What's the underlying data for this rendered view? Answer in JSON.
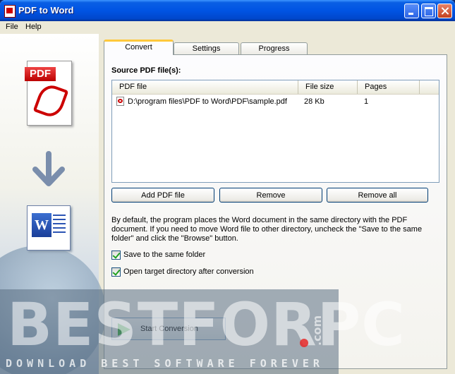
{
  "window": {
    "title": "PDF to Word"
  },
  "menu": {
    "file": "File",
    "help": "Help"
  },
  "sidebar": {
    "pdf_label": "PDF"
  },
  "tabs": [
    "Convert",
    "Settings",
    "Progress"
  ],
  "convert": {
    "source_title": "Source PDF file(s):",
    "columns": [
      "PDF file",
      "File size",
      "Pages"
    ],
    "rows": [
      {
        "file": "D:\\program files\\PDF to Word\\PDF\\sample.pdf",
        "size": "28 Kb",
        "pages": "1"
      }
    ],
    "buttons": {
      "add": "Add PDF file",
      "remove": "Remove",
      "remove_all": "Remove all"
    },
    "description": "By default, the program places the Word document in the same directory with the PDF document. If you need to move Word file to other directory, uncheck the \"Save to the same folder\" and click the \"Browse\" button.",
    "checkboxes": [
      {
        "label": "Save to the same folder",
        "checked": true
      },
      {
        "label": "Open target directory after conversion",
        "checked": true
      }
    ],
    "start_label": "Start Conversion"
  },
  "watermark": {
    "brand": "BESTFORPC",
    "domain": ".com",
    "tagline": "DOWNLOAD BEST SOFTWARE FOREVER"
  },
  "colors": {
    "title_bar": "#0054e3",
    "active_tab_accent": "#ffc83c",
    "play_green": "#2fa637"
  }
}
